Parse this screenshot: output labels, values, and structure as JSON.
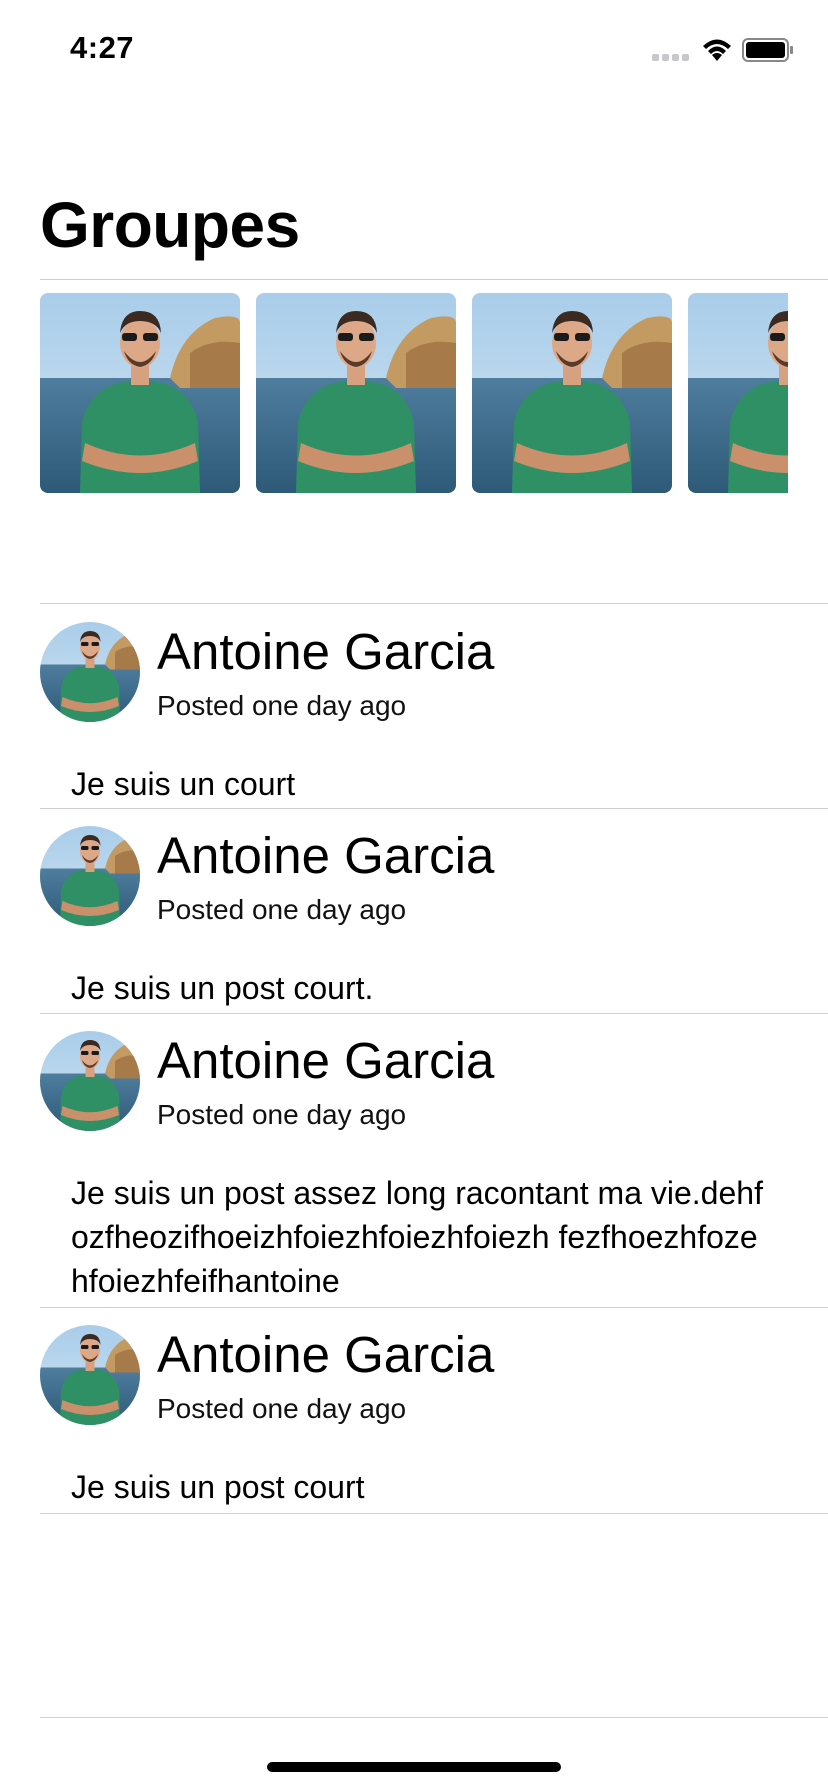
{
  "status_bar": {
    "time": "4:27"
  },
  "page_title": "Groupes",
  "groups": [
    {
      "icon": "group-photo"
    },
    {
      "icon": "group-photo"
    },
    {
      "icon": "group-photo"
    },
    {
      "icon": "group-photo"
    }
  ],
  "posts": [
    {
      "author": "Antoine Garcia",
      "time": "Posted one day ago",
      "body": "Je suis un court"
    },
    {
      "author": "Antoine Garcia",
      "time": "Posted one day ago",
      "body": "Je suis un post court."
    },
    {
      "author": "Antoine Garcia",
      "time": "Posted one day ago",
      "body": "Je suis un post assez long racontant ma vie.dehfozfheozifhoeizhfoiezhfoiezhfoiezh fezfhoezhfozehfoiezhfeifhantoine"
    },
    {
      "author": "Antoine Garcia",
      "time": "Posted one day ago",
      "body": "Je suis un post court"
    }
  ],
  "colors": {
    "separator": "#cfcfd3",
    "text": "#000000",
    "background": "#ffffff"
  }
}
